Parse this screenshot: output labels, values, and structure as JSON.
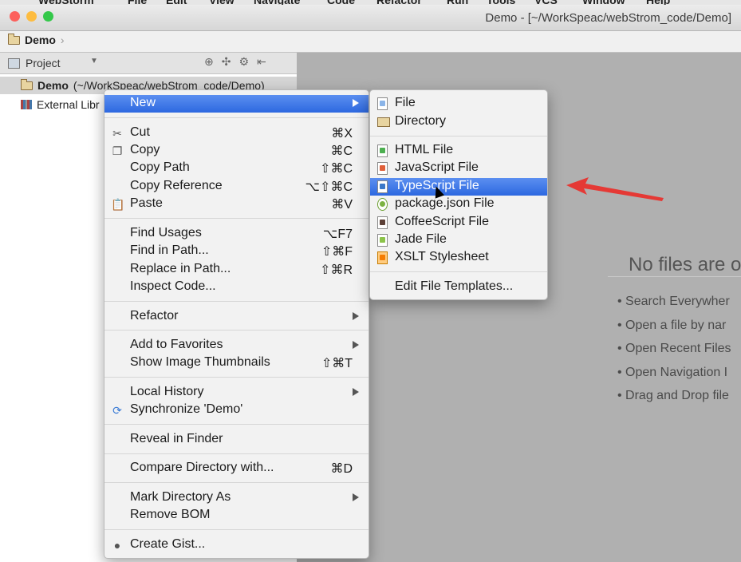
{
  "app": {
    "window_title": "Demo - [~/WorkSpeac/webStrom_code/Demo]",
    "menubar": [
      "WebStorm",
      "File",
      "Edit",
      "View",
      "Navigate",
      "Code",
      "Refactor",
      "Run",
      "Tools",
      "VCS",
      "Window",
      "Help"
    ]
  },
  "navbar": {
    "breadcrumb": "Demo"
  },
  "project_panel": {
    "header_label": "Project",
    "root_name": "Demo",
    "root_path": "(~/WorkSpeac/webStrom_code/Demo)",
    "external_libs": "External Libr"
  },
  "editor_empty": {
    "title": "No files are o",
    "tips": [
      "Search Everywher",
      "Open a file by nar",
      "Open Recent Files",
      "Open Navigation I",
      "Drag and Drop file"
    ]
  },
  "context_menu": {
    "items": [
      {
        "label": "New",
        "shortcut": "",
        "submenu": true,
        "highlighted": true,
        "icon": ""
      },
      {
        "label": "Cut",
        "shortcut": "⌘X",
        "icon": "scissors-icon"
      },
      {
        "label": "Copy",
        "shortcut": "⌘C",
        "icon": "copy-icon"
      },
      {
        "label": "Copy Path",
        "shortcut": "⇧⌘C",
        "icon": ""
      },
      {
        "label": "Copy Reference",
        "shortcut": "⌥⇧⌘C",
        "icon": ""
      },
      {
        "label": "Paste",
        "shortcut": "⌘V",
        "icon": "paste-icon"
      },
      {
        "label": "Find Usages",
        "shortcut": "⌥F7",
        "icon": ""
      },
      {
        "label": "Find in Path...",
        "shortcut": "⇧⌘F",
        "icon": ""
      },
      {
        "label": "Replace in Path...",
        "shortcut": "⇧⌘R",
        "icon": ""
      },
      {
        "label": "Inspect Code...",
        "shortcut": "",
        "icon": ""
      },
      {
        "label": "Refactor",
        "shortcut": "",
        "submenu": true,
        "icon": ""
      },
      {
        "label": "Add to Favorites",
        "shortcut": "",
        "submenu": true,
        "icon": ""
      },
      {
        "label": "Show Image Thumbnails",
        "shortcut": "⇧⌘T",
        "icon": ""
      },
      {
        "label": "Local History",
        "shortcut": "",
        "submenu": true,
        "icon": ""
      },
      {
        "label": "Synchronize 'Demo'",
        "shortcut": "",
        "icon": "sync-icon"
      },
      {
        "label": "Reveal in Finder",
        "shortcut": "",
        "icon": ""
      },
      {
        "label": "Compare Directory with...",
        "shortcut": "⌘D",
        "icon": ""
      },
      {
        "label": "Mark Directory As",
        "shortcut": "",
        "submenu": true,
        "icon": ""
      },
      {
        "label": "Remove BOM",
        "shortcut": "",
        "icon": ""
      },
      {
        "label": "Create Gist...",
        "shortcut": "",
        "icon": "github-icon"
      }
    ]
  },
  "new_submenu": {
    "items": [
      {
        "label": "File",
        "icon": "file-icon"
      },
      {
        "label": "Directory",
        "icon": "folder-icon"
      },
      {
        "label": "HTML File",
        "icon": "html-file-icon"
      },
      {
        "label": "JavaScript File",
        "icon": "javascript-file-icon"
      },
      {
        "label": "TypeScript File",
        "icon": "typescript-file-icon",
        "highlighted": true
      },
      {
        "label": "package.json File",
        "icon": "package-json-icon"
      },
      {
        "label": "CoffeeScript File",
        "icon": "coffeescript-file-icon"
      },
      {
        "label": "Jade File",
        "icon": "jade-file-icon"
      },
      {
        "label": "XSLT Stylesheet",
        "icon": "xslt-file-icon"
      },
      {
        "label": "Edit File Templates...",
        "icon": ""
      }
    ]
  },
  "colors": {
    "highlight": "#2d68e0",
    "annotation_arrow": "#e53935"
  }
}
